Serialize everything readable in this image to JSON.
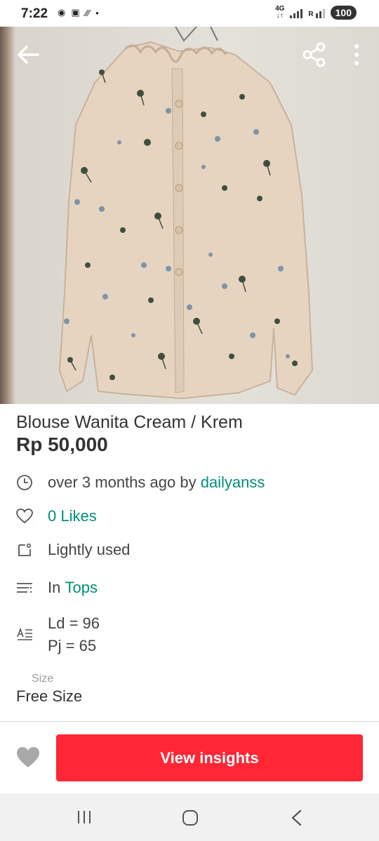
{
  "status_bar": {
    "time": "7:22",
    "network": "4G",
    "sim": "R",
    "battery": "100"
  },
  "product": {
    "title": "Blouse Wanita Cream / Krem",
    "price": "Rp 50,000",
    "posted_text": "over 3 months ago by ",
    "seller": "dailyanss",
    "likes": "0 Likes",
    "condition": "Lightly used",
    "category_prefix": "In ",
    "category": "Tops",
    "measure_1": "Ld = 96",
    "measure_2": "Pj = 65",
    "size_label": "Size",
    "size_value": "Free Size"
  },
  "actions": {
    "view_insights": "View insights"
  },
  "icons": {
    "back": "arrow-left-icon",
    "share": "share-icon",
    "more": "more-vertical-icon",
    "clock": "clock-icon",
    "heart": "heart-icon",
    "condition": "tag-icon",
    "category": "list-icon",
    "description": "text-icon",
    "like": "heart-filled-icon"
  },
  "colors": {
    "accent": "#008f7a",
    "cta": "#ff2636"
  }
}
